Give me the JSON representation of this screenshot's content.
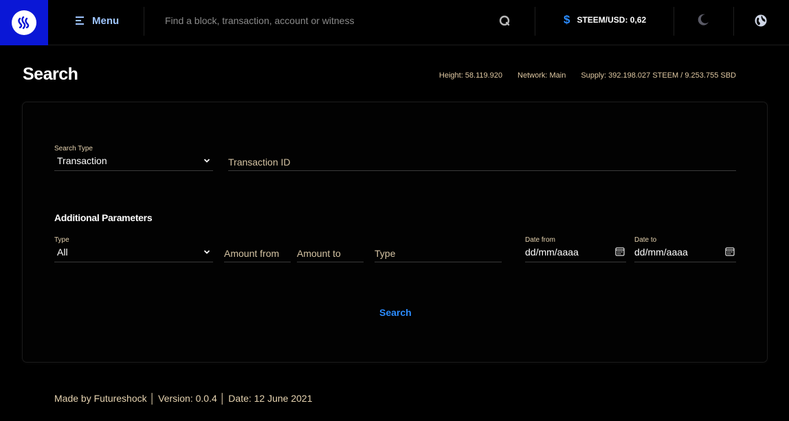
{
  "header": {
    "menu_label": "Menu",
    "search_placeholder": "Find a block, transaction, account or witness",
    "price_label": "STEEM/USD: 0,62"
  },
  "page": {
    "title": "Search",
    "stats": {
      "height": "Height: 58.119.920",
      "network": "Network: Main",
      "supply": "Supply: 392.198.027 STEEM / 9.253.755 SBD"
    }
  },
  "form": {
    "search_type": {
      "label": "Search Type",
      "value": "Transaction"
    },
    "transaction_id_placeholder": "Transaction ID",
    "additional_title": "Additional Parameters",
    "type_select": {
      "label": "Type",
      "value": "All"
    },
    "amount_from_placeholder": "Amount from",
    "amount_to_placeholder": "Amount to",
    "type_input_placeholder": "Type",
    "date_from": {
      "label": "Date from",
      "value": "dd/mm/aaaa"
    },
    "date_to": {
      "label": "Date to",
      "value": "dd/mm/aaaa"
    },
    "search_button": "Search"
  },
  "footer": {
    "text": "Made by Futureshock │ Version: 0.0.4 │ Date: 12 June 2021"
  },
  "colors": {
    "brand_blue": "#0a17d6",
    "accent_blue": "#2b8cff",
    "label_tan": "#e6d3b0"
  }
}
